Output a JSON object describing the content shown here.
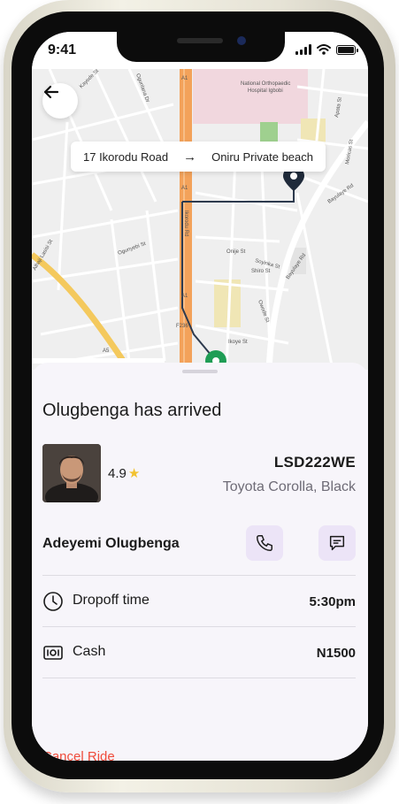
{
  "status_bar": {
    "time": "9:41"
  },
  "map": {
    "origin": "17 Ikorodu Road",
    "destination": "Oniru Private beach",
    "labels": {
      "hospital": "National Orthopaedic",
      "hospital2": "Hospital Igbobi",
      "road_main": "Ikorodu Rd",
      "road_a1": "A1",
      "road_a1b": "A1",
      "road_a1c": "A1",
      "road_f236": "F236",
      "road_bayulaye": "Bayulaye Rd",
      "road_bayulaye2": "Bayulaye Rd",
      "road_moricas": "Moricas St",
      "road_apata": "Apata St",
      "road_alhaji": "Alhaji Lasisi St",
      "road_ogunyebi": "Ogunyebi St",
      "road_onije": "Onije St",
      "road_soyinka": "Soyinka St",
      "road_shiro": "Shiro St",
      "road_owode": "Owode St",
      "road_ikoye": "Ikoye St",
      "road_ogunlana": "Ogunlana Dr",
      "road_kayode": "Kayode St",
      "road_a5": "A5"
    }
  },
  "trip": {
    "title": "Olugbenga has arrived",
    "rating": "4.9",
    "plate": "LSD222WE",
    "car": "Toyota Corolla, Black",
    "driver_name": "Adeyemi Olugbenga",
    "dropoff_label": "Dropoff time",
    "dropoff_time": "5:30pm",
    "payment_label": "Cash",
    "payment_amount": "N1500",
    "cancel_label": "Cancel Ride"
  },
  "colors": {
    "accent_soft": "#ece4f7",
    "cancel": "#ef4b3a",
    "main_road": "#f3a25a",
    "secondary_road": "#f4c95d",
    "pin_green": "#1f9d55",
    "route_line": "#2d3a4e"
  },
  "icons": [
    "back-arrow-icon",
    "arrow-right-icon",
    "star-icon",
    "phone-icon",
    "chat-icon",
    "clock-icon",
    "cash-icon",
    "destination-pin-icon",
    "car-pin-icon"
  ]
}
